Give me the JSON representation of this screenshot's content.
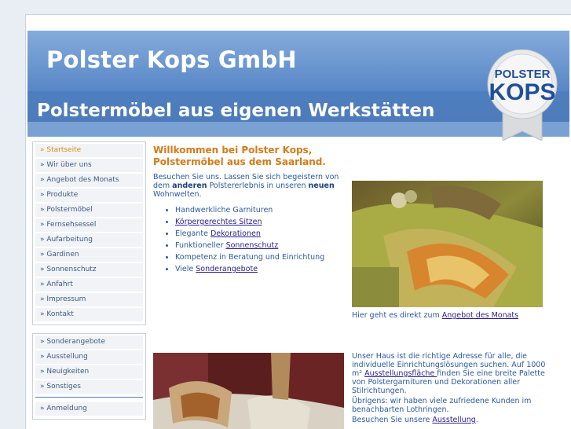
{
  "header": {
    "company": "Polster Kops GmbH",
    "tagline": "Polstermöbel aus eigenen Werkstätten",
    "logo_line1": "POLSTER",
    "logo_line2": "KOPS"
  },
  "sidebar": {
    "main_menu": [
      {
        "label": "» Startseite",
        "active": true
      },
      {
        "label": "» Wir über uns"
      },
      {
        "label": "» Angebot des Monats"
      },
      {
        "label": "» Produkte"
      },
      {
        "label": "» Polstermöbel"
      },
      {
        "label": "» Fernsehsessel"
      },
      {
        "label": "» Aufarbeitung"
      },
      {
        "label": "» Gardinen"
      },
      {
        "label": "» Sonnenschutz"
      },
      {
        "label": "» Anfahrt"
      },
      {
        "label": "» Impressum"
      },
      {
        "label": "» Kontakt"
      }
    ],
    "secondary_menu": [
      {
        "label": "» Sonderangebote"
      },
      {
        "label": "» Ausstellung"
      },
      {
        "label": "» Neuigkeiten"
      },
      {
        "label": "» Sonstiges"
      }
    ],
    "login": "» Anmeldung"
  },
  "main": {
    "welcome_line1": "Willkommen bei Polster Kops,",
    "welcome_line2": "Polstermöbel aus dem Saarland.",
    "intro_a": "Besuchen Sie uns. Lassen Sie sich begeistern von dem ",
    "intro_b": "anderen",
    "intro_c": " Polstererlebnis in unseren ",
    "intro_d": "neuen",
    "intro_e": " Wohnwelten.",
    "features": {
      "f1": "Handwerkliche Garniture­n",
      "f2_link": "Körpergerechtes Sitzen",
      "f3_text": "Elegante ",
      "f3_link": "Dekorationen",
      "f4_text": "Funktioneller ",
      "f4_link": "Sonnenschutz",
      "f5": "Kompetenz in Beratung und Einrichtung",
      "f6_text": "Viele ",
      "f6_link": "Sonderangebote"
    },
    "caption1_text": "Hier geht es direkt zum ",
    "caption1_link": "Angebot des Monats",
    "para_a": "Unser Haus ist die richtige Adresse für alle, die individuelle Einrichtungslösungen suchen. Auf 1000 m² ",
    "para_a_link": "Ausstellungsfläche ",
    "para_a_rest": "finden Sie eine breite Palette von Polstergarnituren und Dekorationen aller Stilrichtungen.",
    "para_b": "Übrigens: wir haben viele zufriedene Kunden im benachbarten Lothringen.",
    "para_c_text": "Besuchen Sie unsere ",
    "para_c_link": "Ausstellung",
    "para_c_end": "."
  }
}
